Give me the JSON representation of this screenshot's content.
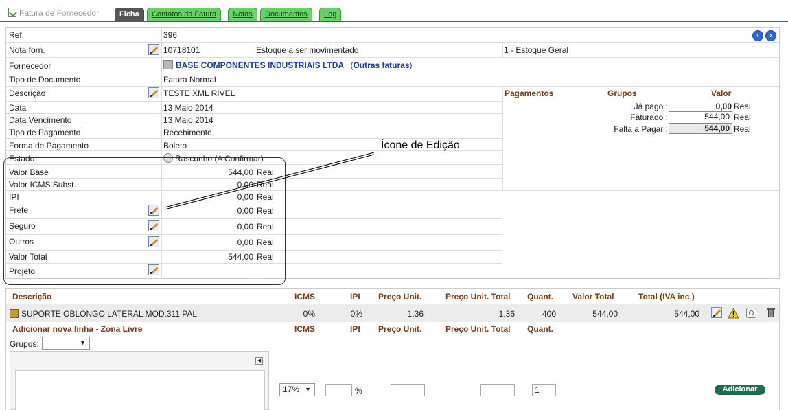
{
  "header": {
    "title": "Fatura de Fornecedor",
    "tabs": [
      {
        "label": "Ficha"
      },
      {
        "label": "Contatos da Fatura"
      },
      {
        "label": "Notas"
      },
      {
        "label": "Documentos"
      },
      {
        "label": "Log"
      }
    ]
  },
  "form": {
    "ref_label": "Ref.",
    "ref_value": "396",
    "nota_label": "Nota forn.",
    "nota_value": "10718101",
    "estoque_label": "Estoque a ser movimentado",
    "estoque_value": "1 - Estoque Geral",
    "fornecedor_label": "Fornecedor",
    "fornecedor_value": "BASE COMPONENTES INDUSTRIAIS LTDA",
    "outras_faturas_link": "Outras faturas",
    "tipo_doc_label": "Tipo de Documento",
    "tipo_doc_value": "Fatura Normal",
    "descricao_label": "Descrição",
    "descricao_value": "TESTE XML RIVEL",
    "data_label": "Data",
    "data_value": "13 Maio 2014",
    "venc_label": "Data Vencimento",
    "venc_value": "13 Maio 2014",
    "tipo_pag_label": "Tipo de Pagamento",
    "tipo_pag_value": "Recebimento",
    "forma_pag_label": "Forma de Pagamento",
    "forma_pag_value": "Boleto",
    "estado_label": "Estado",
    "estado_value": "Rascunho (A Confirmar)",
    "valor_base_label": "Valor Base",
    "valor_base_value": "544,00",
    "icms_subst_label": "Valor ICMS Subst.",
    "icms_subst_value": "0,00",
    "ipi_label": "IPI",
    "ipi_value": "0,00",
    "frete_label": "Frete",
    "frete_value": "0,00",
    "seguro_label": "Seguro",
    "seguro_value": "0,00",
    "outros_label": "Outros",
    "outros_value": "0,00",
    "valor_total_label": "Valor Total",
    "valor_total_value": "544,00",
    "projeto_label": "Projeto",
    "currency": "Real"
  },
  "annotation": {
    "label": "Ícone de Edição"
  },
  "payments": {
    "pagamentos_header": "Pagamentos",
    "grupos_header": "Grupos",
    "valor_header": "Valor",
    "ja_pago_label": "Já pago :",
    "ja_pago_value": "0,00",
    "faturado_label": "Faturado :",
    "faturado_value": "544,00",
    "falta_label": "Falta a Pagar :",
    "falta_value": "544,00",
    "currency": "Real"
  },
  "lines": {
    "headers": [
      "Descrição",
      "ICMS",
      "IPI",
      "Preço Unit.",
      "Preço Unit. Total",
      "Quant.",
      "Valor Total",
      "Total (IVA inc.)"
    ],
    "row": {
      "descricao": "SUPORTE OBLONGO LATERAL MOD.311 PAL",
      "icms": "0%",
      "ipi": "0%",
      "preco_unit": "1,36",
      "preco_unit_total": "1,36",
      "quant": "400",
      "valor_total": "544,00",
      "total_iva": "544,00"
    },
    "add_title": "Adicionar nova linha - Zona Livre",
    "add_headers": [
      "ICMS",
      "IPI",
      "Preço Unit.",
      "Preço Unit. Total",
      "Quant."
    ],
    "grupos_label": "Grupos:",
    "icms_select": "17%",
    "ipi_suffix": "%",
    "quant_value": "1",
    "add_button": "Adicionar"
  }
}
